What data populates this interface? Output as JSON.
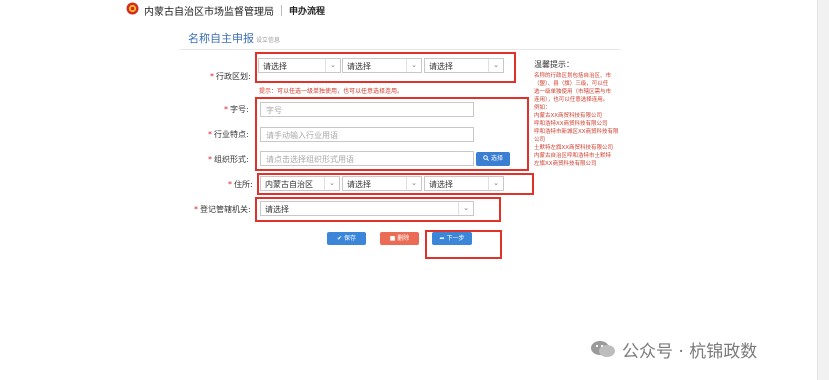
{
  "header": {
    "agency_name": "内蒙古自治区市场监督管理局",
    "breadcrumb": "申办流程"
  },
  "form": {
    "title": "名称自主申报",
    "subtitle": "设立信息",
    "district": {
      "label": "行政区划:",
      "selects": [
        "请选择",
        "请选择",
        "请选择"
      ],
      "hint": "提示：可以任选一级单独使用，也可以任意选择连用。"
    },
    "zihao": {
      "label": "字号:",
      "placeholder": "字号"
    },
    "industry": {
      "label": "行业特点:",
      "placeholder": "请手动输入行业用语"
    },
    "org_form": {
      "label": "组织形式:",
      "placeholder": "请点击选择组织形式用语",
      "pick_button": "选择"
    },
    "address": {
      "label": "住所:",
      "selects": [
        "内蒙古自治区",
        "请选择",
        "请选择"
      ]
    },
    "authority": {
      "label": "登记管辖机关:",
      "select": "请选择"
    },
    "buttons": {
      "save": "保存",
      "delete": "删除",
      "next": "下一步"
    }
  },
  "tips": {
    "title": "温馨提示：",
    "lines": [
      "名称的行政区划包括自治区、市",
      "（盟）、县（旗）三级，可以任",
      "选一级单独使用（市辖区需与市",
      "连用），也可以任意选择连用。",
      "例如：",
      "内蒙古XX商贸科技有限公司",
      "呼和浩特XX商贸科技有限公司",
      "呼和浩特市新城区XX商贸科技有限",
      "公司",
      "土默特左旗XX商贸科技有限公司",
      "内蒙古自治区呼和浩特市土默特",
      "左旗XX商贸科技有限公司"
    ]
  },
  "watermark": {
    "text": "公众号 · 杭锦政数"
  },
  "colors": {
    "accent": "#3b86d8",
    "danger": "#ea6c55",
    "highlight": "#e0312b",
    "hint": "#d03a2a"
  },
  "icons": {
    "emblem": "national-emblem-icon",
    "chevron": "chevron-down-icon",
    "search": "search-icon",
    "check": "check-icon",
    "trash": "trash-icon",
    "arrow": "arrow-right-icon",
    "wechat": "wechat-icon"
  }
}
